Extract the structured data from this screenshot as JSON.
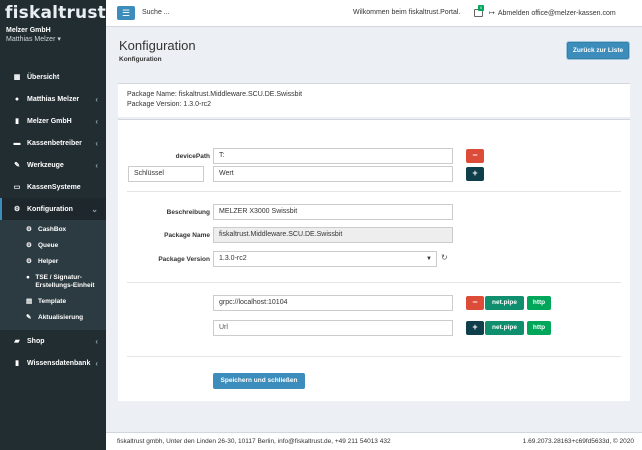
{
  "brand": "fiskaltrust.",
  "user": {
    "company": "Melzer GmbH",
    "name": "Matthias Melzer ▾"
  },
  "sidebar": {
    "items": [
      {
        "label": "Übersicht",
        "icon": "dashboard-icon"
      },
      {
        "label": "Matthias Melzer",
        "icon": "user-icon"
      },
      {
        "label": "Melzer GmbH",
        "icon": "building-icon"
      },
      {
        "label": "Kassenbetreiber",
        "icon": "briefcase-icon"
      },
      {
        "label": "Werkzeuge",
        "icon": "wrench-icon"
      },
      {
        "label": "KassenSysteme",
        "icon": "register-icon"
      },
      {
        "label": "Konfiguration",
        "icon": "cogs-icon"
      }
    ],
    "sub": [
      {
        "label": "CashBox",
        "icon": "gear-icon"
      },
      {
        "label": "Queue",
        "icon": "gear-icon"
      },
      {
        "label": "Helper",
        "icon": "gear-icon"
      },
      {
        "label": "TSE / Signatur-Erstellungs-Einheit",
        "icon": "circle-icon"
      },
      {
        "label": "Template",
        "icon": "file-icon"
      },
      {
        "label": "Aktualisierung",
        "icon": "wrench-icon"
      }
    ],
    "bottom": [
      {
        "label": "Shop",
        "icon": "shop-icon"
      },
      {
        "label": "Wissensdatenbank",
        "icon": "book-icon"
      }
    ]
  },
  "topbar": {
    "search_label": "Suche ...",
    "welcome": "Wilkommen beim fiskaltrust.Portal.",
    "notification_count": "0",
    "logout": "Abmelden office@melzer-kassen.com"
  },
  "page": {
    "title": "Konfiguration",
    "subtitle": "Konfiguration",
    "back_button": "Zurück zur Liste"
  },
  "package": {
    "name_line": "Package Name: fiskaltrust.Middleware.SCU.DE.Swissbit",
    "version_line": "Package Version: 1.3.0-rc2"
  },
  "form": {
    "device_path_label": "devicePath",
    "device_path_value": "T:",
    "key_placeholder": "Schlüssel",
    "value_placeholder": "Wert",
    "description_label": "Beschreibung",
    "description_value": "MELZER X3000 Swissbit",
    "package_name_label": "Package Name",
    "package_name_value": "fiskaltrust.Middleware.SCU.DE.Swissbit",
    "package_version_label": "Package Version",
    "package_version_value": "1.3.0-rc2",
    "url_value": "grpc://localhost:10104",
    "url_placeholder": "Url",
    "btn_netpipe": "net.pipe",
    "btn_http": "http",
    "save_button": "Speichern und schließen"
  },
  "footer": {
    "left": "fiskaltrust gmbh, Unter den Linden 26-30, 10117 Berlin, info@fiskaltrust.de, +49 211 54013 432",
    "right": "1.69.2073.28163+c69fd5633d, © 2020"
  }
}
